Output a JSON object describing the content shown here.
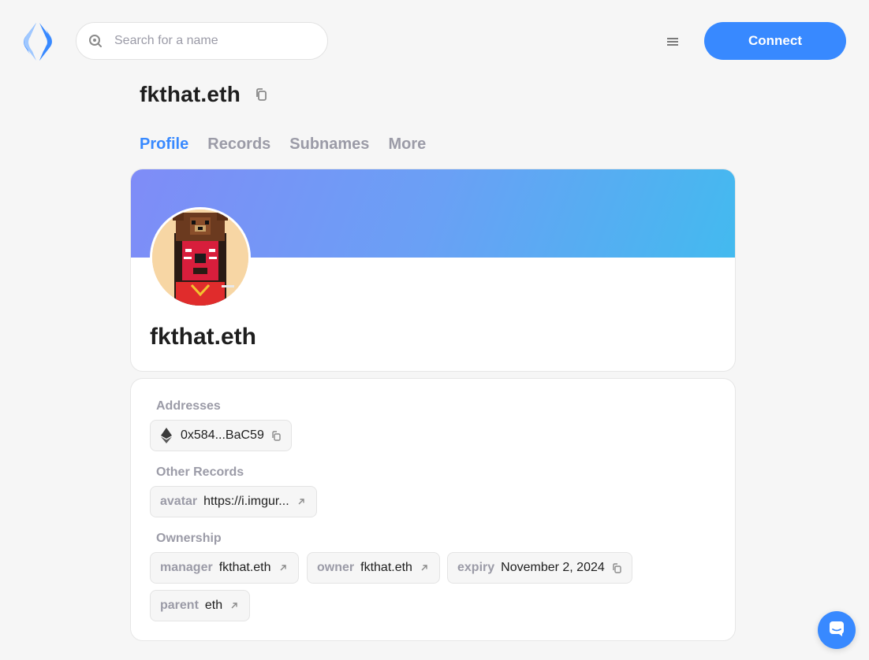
{
  "header": {
    "search_placeholder": "Search for a name",
    "connect_label": "Connect"
  },
  "name": "fkthat.eth",
  "tabs": [
    "Profile",
    "Records",
    "Subnames",
    "More"
  ],
  "profile": {
    "display_name": "fkthat.eth"
  },
  "records": {
    "addresses_label": "Addresses",
    "address": "0x584...BaC59",
    "other_label": "Other Records",
    "avatar_key": "avatar",
    "avatar_value": "https://i.imgur...",
    "ownership_label": "Ownership",
    "ownership": [
      {
        "key": "manager",
        "value": "fkthat.eth"
      },
      {
        "key": "owner",
        "value": "fkthat.eth"
      },
      {
        "key": "expiry",
        "value": "November 2, 2024"
      },
      {
        "key": "parent",
        "value": "eth"
      }
    ]
  },
  "colors": {
    "accent": "#3889ff",
    "muted": "#9b9ba7",
    "banner_start": "#7f8cf7",
    "banner_end": "#43baef"
  }
}
